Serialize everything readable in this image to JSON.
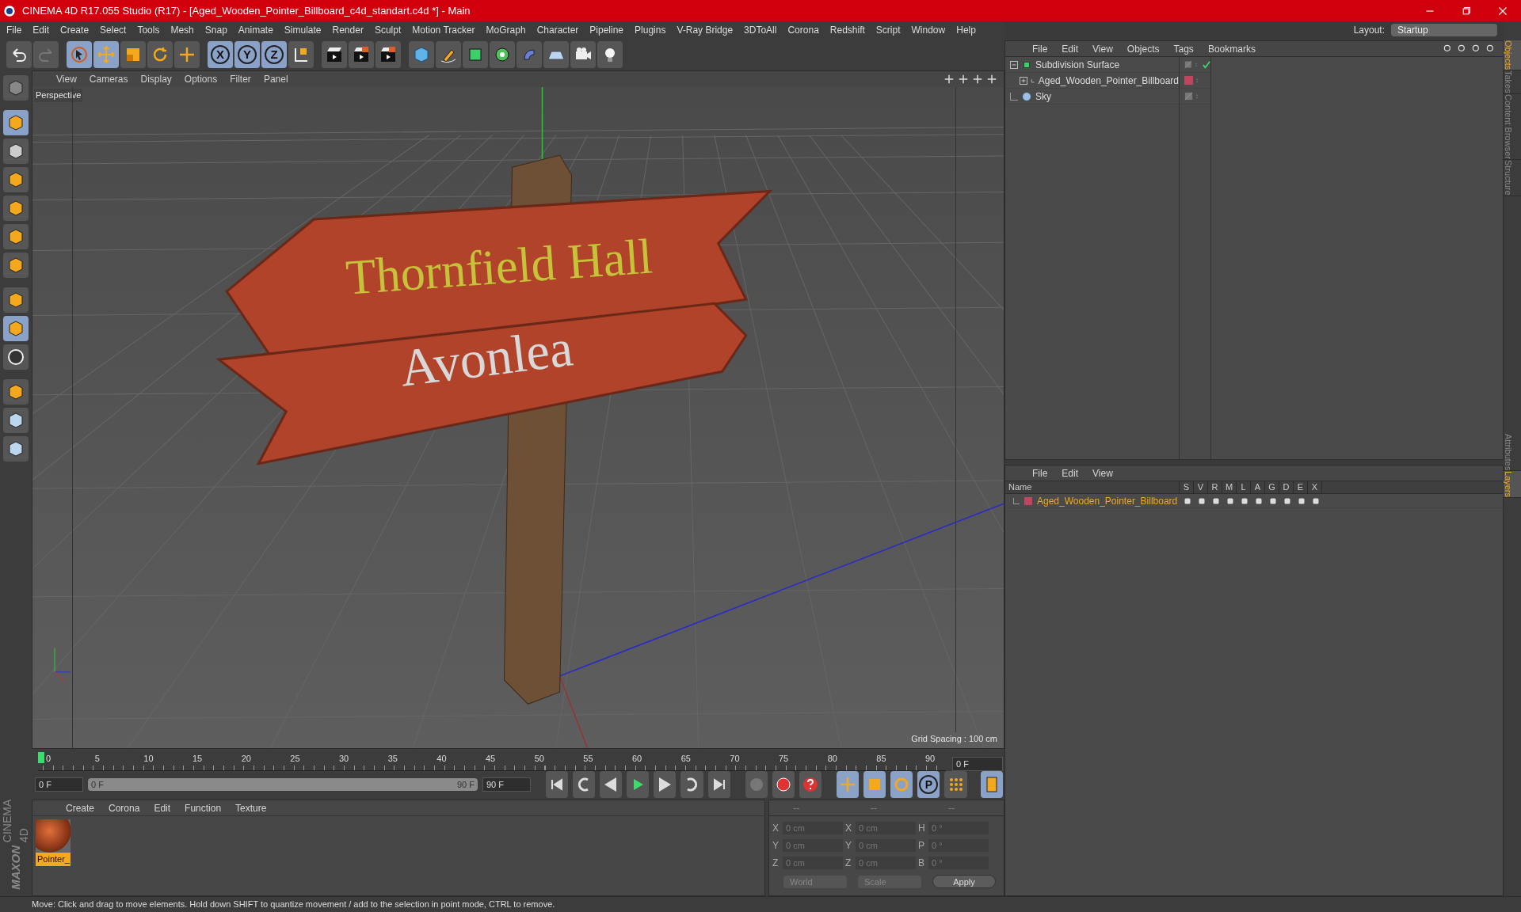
{
  "window": {
    "title": "CINEMA 4D R17.055 Studio (R17) - [Aged_Wooden_Pointer_Billboard_c4d_standart.c4d *] - Main"
  },
  "menu": [
    "File",
    "Edit",
    "Create",
    "Select",
    "Tools",
    "Mesh",
    "Snap",
    "Animate",
    "Simulate",
    "Render",
    "Sculpt",
    "Motion Tracker",
    "MoGraph",
    "Character",
    "Pipeline",
    "Plugins",
    "V-Ray Bridge",
    "3DToAll",
    "Corona",
    "Redshift",
    "Script",
    "Window",
    "Help"
  ],
  "layout": {
    "label": "Layout:",
    "value": "Startup"
  },
  "axis_buttons": [
    {
      "label": "X",
      "on": true
    },
    {
      "label": "Y",
      "on": true
    },
    {
      "label": "Z",
      "on": true
    }
  ],
  "viewport": {
    "menu": [
      "View",
      "Cameras",
      "Display",
      "Options",
      "Filter",
      "Panel"
    ],
    "camera": "Perspective",
    "grid_spacing": "Grid Spacing : 100 cm",
    "sign_texts": [
      "Thornfield Hall",
      "Avonlea"
    ]
  },
  "timeline": {
    "ticks": [
      "0",
      "5",
      "10",
      "15",
      "20",
      "25",
      "30",
      "35",
      "40",
      "45",
      "50",
      "55",
      "60",
      "65",
      "70",
      "75",
      "80",
      "85",
      "90"
    ],
    "current_frame": "0 F",
    "start_field": "0 F",
    "range": {
      "start": "0 F",
      "end": "90 F",
      "level": 1
    },
    "end_field": "90 F",
    "param_button": "P"
  },
  "materials": {
    "menu": [
      "Create",
      "Corona",
      "Edit",
      "Function",
      "Texture"
    ],
    "items": [
      {
        "name": "Pointer_",
        "selected": true
      }
    ]
  },
  "coordinates": {
    "headers": [
      "--",
      "--",
      "--"
    ],
    "rows": [
      {
        "a": "X",
        "a_value": "0 cm",
        "b": "X",
        "b_value": "0 cm",
        "c": "H",
        "c_value": "0 °"
      },
      {
        "a": "Y",
        "a_value": "0 cm",
        "b": "Y",
        "b_value": "0 cm",
        "c": "P",
        "c_value": "0 °"
      },
      {
        "a": "Z",
        "a_value": "0 cm",
        "b": "Z",
        "b_value": "0 cm",
        "c": "B",
        "c_value": "0 °"
      }
    ],
    "mode": "World",
    "transform": "Scale",
    "apply": "Apply"
  },
  "objects": {
    "menu": [
      "File",
      "Edit",
      "View",
      "Objects",
      "Tags",
      "Bookmarks"
    ],
    "tree": [
      {
        "name": "Subdivision Surface",
        "kind": "subdivision",
        "expanded": true,
        "enabled": true,
        "children": [
          {
            "name": "Aged_Wooden_Pointer_Billboard",
            "kind": "null",
            "expanded": false,
            "color": "#c0455f"
          }
        ]
      },
      {
        "name": "Sky",
        "kind": "sky"
      }
    ]
  },
  "layers": {
    "menu": [
      "File",
      "Edit",
      "View"
    ],
    "columns": [
      "Name",
      "S",
      "V",
      "R",
      "M",
      "L",
      "A",
      "G",
      "D",
      "E",
      "X"
    ],
    "rows": [
      {
        "name": "Aged_Wooden_Pointer_Billboard",
        "color": "#c0455f"
      }
    ]
  },
  "side_tabs": [
    {
      "label": "Objects",
      "selected": true
    },
    {
      "label": "Takes",
      "selected": false
    },
    {
      "label": "Content Browser",
      "selected": false
    },
    {
      "label": "Structure",
      "selected": false
    }
  ],
  "side_tabs_lower": [
    {
      "label": "Attributes",
      "selected": false
    },
    {
      "label": "Layers",
      "selected": true
    }
  ],
  "logo": {
    "brand": "MAXON",
    "product": "CINEMA 4D"
  },
  "status_bar": "Move: Click and drag to move elements. Hold down SHIFT to quantize movement / add to the selection in point mode, CTRL to remove."
}
